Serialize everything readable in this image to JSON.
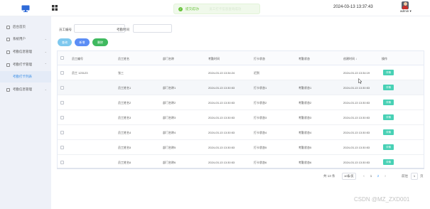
{
  "header": {
    "toast_text": "提交成功!",
    "toast_ghost": "员工打卡信息查询成功",
    "datetime": "2024-03-13 13:37:43",
    "user": "admin ▾"
  },
  "sidebar": {
    "items": [
      {
        "label": "后台首页",
        "chev": ""
      },
      {
        "label": "系统用户",
        "chev": "⌄"
      },
      {
        "label": "考勤信息管理",
        "chev": "⌄"
      },
      {
        "label": "考勤打卡管理",
        "chev": "⌃"
      },
      {
        "label": "考勤打卡列表",
        "chev": ""
      },
      {
        "label": "考勤信息管理",
        "chev": "⌄"
      }
    ]
  },
  "search": {
    "label1": "员工编号",
    "label2": "考勤时间",
    "input1_value": "",
    "input2_value": ""
  },
  "buttons": {
    "query": "查询",
    "add": "新增",
    "delete": "删除"
  },
  "colors": {
    "query_btn": "#7ec8ee",
    "add_btn": "#5b8df5",
    "delete_btn": "#3fb95f",
    "op_btn": "#48d1b5",
    "sidebar_bg": "#eef1f8",
    "toast_green": "#67c23a"
  },
  "table": {
    "headers": [
      "员工编号",
      "员工姓名",
      "部门名称",
      "考勤时间",
      "打卡状态",
      "考勤状态",
      "创建时间 ↓",
      "操作"
    ],
    "op_label": "详情",
    "rows": [
      [
        "员工 123123",
        "张三",
        "",
        "2024-03-13 13:34:24",
        "迟到",
        "",
        "2024-03-13 13:34:19"
      ],
      [
        "",
        "员工姓名1",
        "部门名称1",
        "2024-03-13 13:30:53",
        "打卡状态1",
        "考勤状态1",
        "2024-03-13 13:30:53"
      ],
      [
        "",
        "员工姓名2",
        "部门名称2",
        "2024-03-13 13:30:53",
        "打卡状态2",
        "考勤状态2",
        "2024-03-13 13:30:53"
      ],
      [
        "",
        "员工姓名3",
        "部门名称3",
        "2024-03-13 13:30:53",
        "打卡状态3",
        "考勤状态3",
        "2024-03-13 13:30:53"
      ],
      [
        "",
        "员工姓名4",
        "部门名称4",
        "2024-03-13 13:30:53",
        "打卡状态4",
        "考勤状态4",
        "2024-03-13 13:30:53"
      ],
      [
        "",
        "员工姓名5",
        "部门名称5",
        "2024-03-13 13:30:53",
        "打卡状态5",
        "考勤状态5",
        "2024-03-13 13:30:53"
      ],
      [
        "",
        "员工姓名6",
        "部门名称6",
        "2024-03-13 13:30:53",
        "打卡状态6",
        "考勤状态6",
        "2024-03-13 13:30:53"
      ]
    ]
  },
  "pagination": {
    "total": "共 13 条",
    "page_size": "10条/页",
    "prev": "‹",
    "pages": [
      "1",
      "2"
    ],
    "next": "›",
    "goto": "前往",
    "goto_value": "1",
    "suffix": "页"
  },
  "watermark": "CSDN @MZ_ZXD001"
}
